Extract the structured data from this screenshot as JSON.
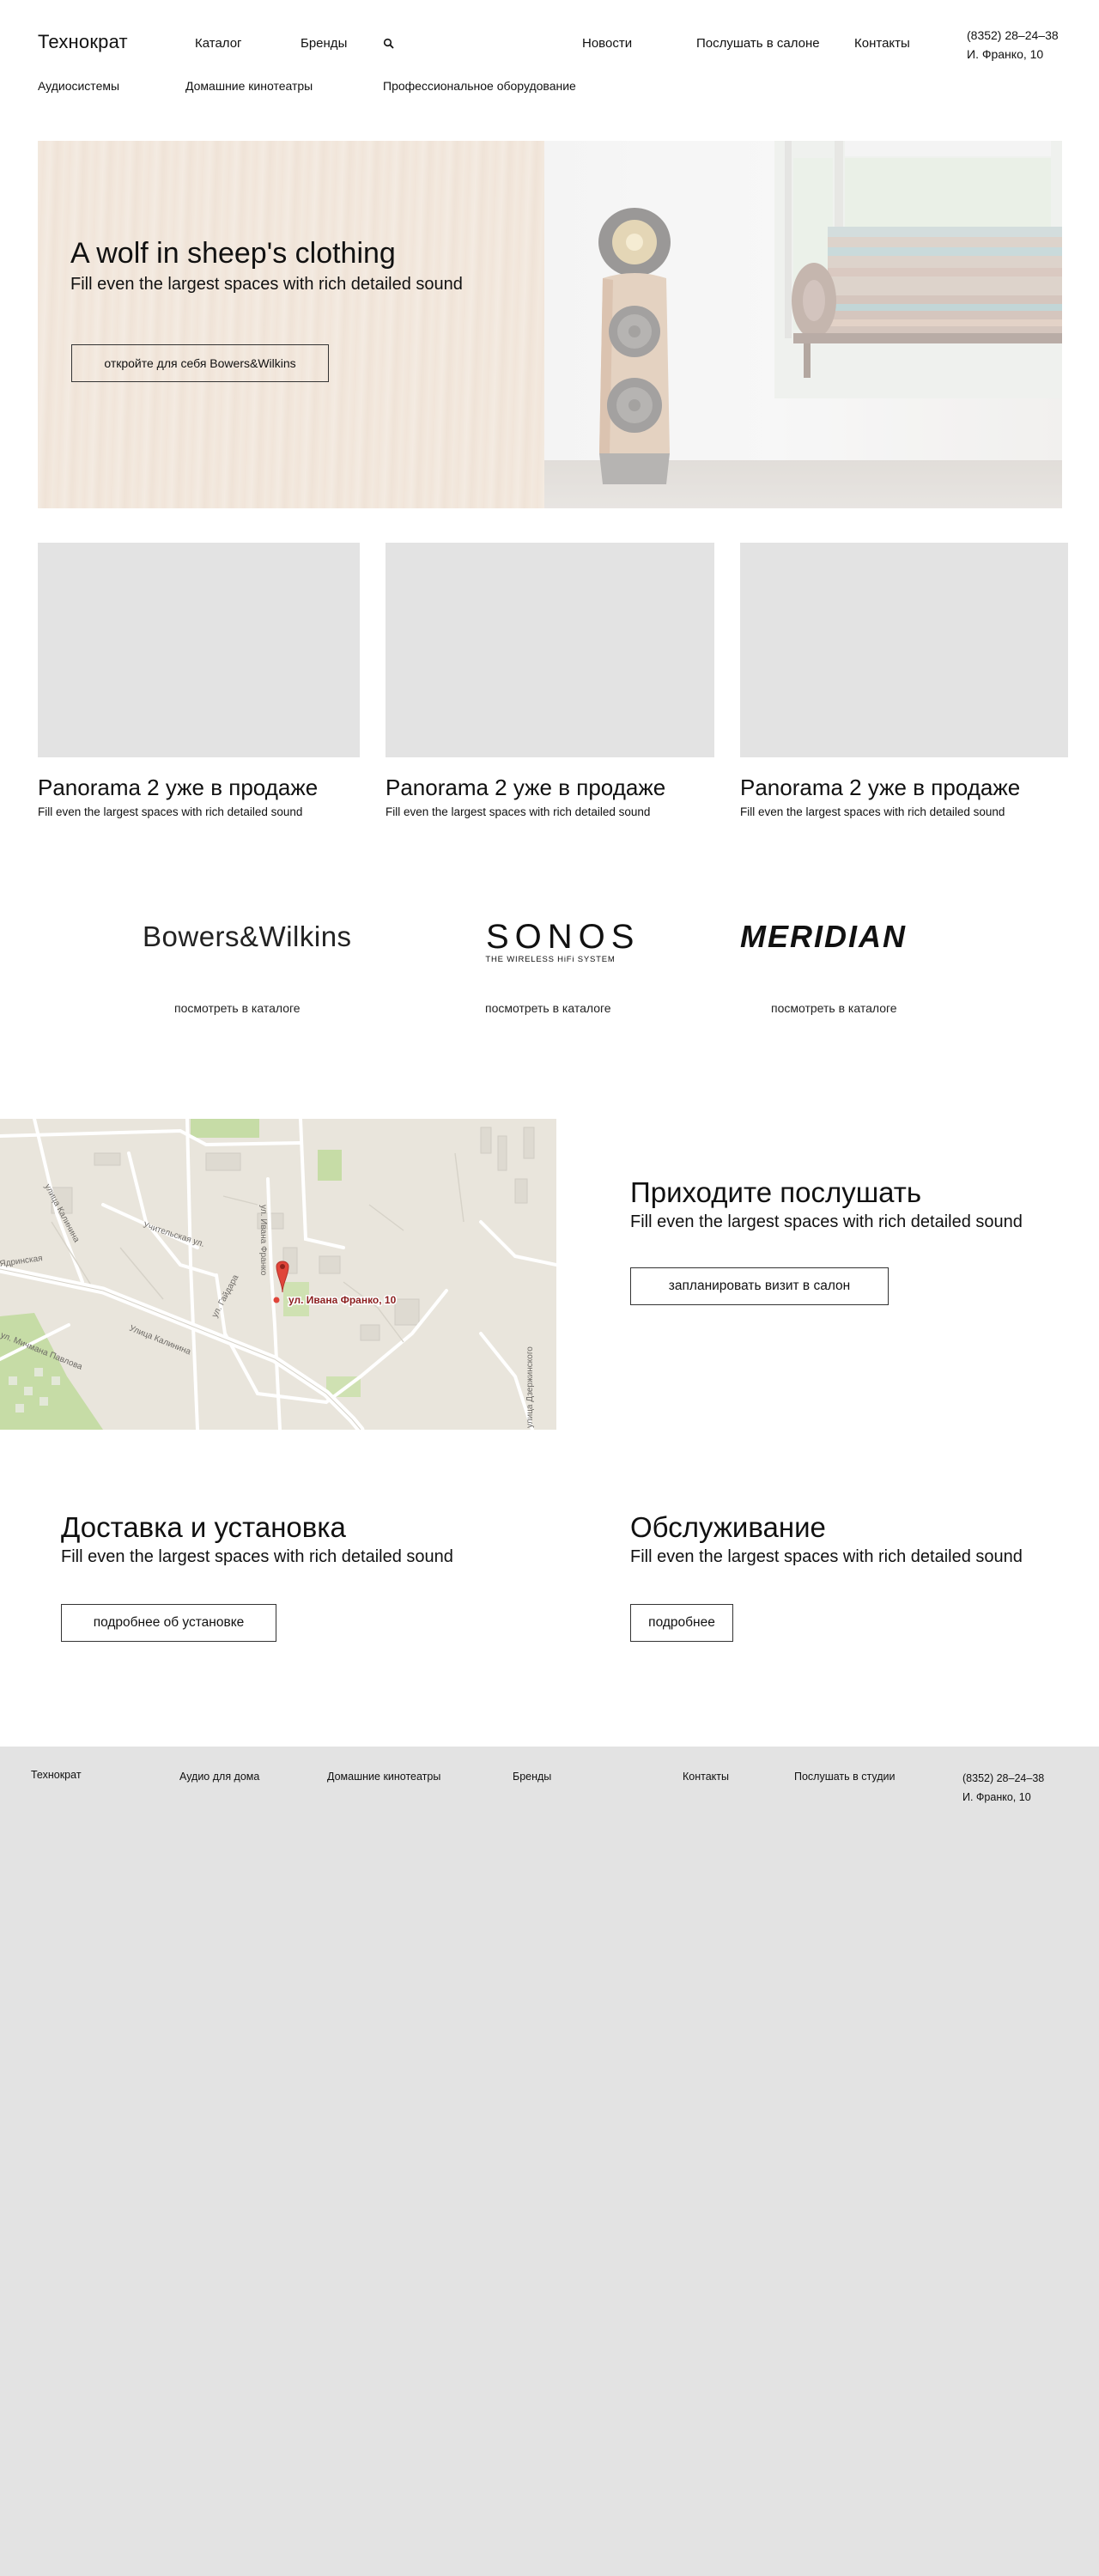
{
  "header": {
    "logo": "Технократ",
    "nav": [
      "Каталог",
      "Бренды",
      "Новости",
      "Послушать в салоне",
      "Контакты"
    ],
    "phone": "(8352) 28–24–38",
    "address": "И. Франко, 10",
    "subnav": [
      "Аудиосистемы",
      "Домашние кинотеатры",
      "Профессиональное оборудование"
    ],
    "icons": {
      "search": "search-icon"
    }
  },
  "hero": {
    "title": "A wolf in sheep's clothing",
    "subtitle": "Fill even the largest spaces with rich detailed sound",
    "button": "откройте для себя Bowers&Wilkins"
  },
  "cards": [
    {
      "title": "Panorama 2 уже в продаже",
      "subtitle": "Fill even the largest spaces with rich detailed sound"
    },
    {
      "title": "Panorama 2 уже в продаже",
      "subtitle": "Fill even the largest spaces with rich detailed sound"
    },
    {
      "title": "Panorama 2 уже в продаже",
      "subtitle": "Fill even the largest spaces with rich detailed sound"
    }
  ],
  "brands": [
    {
      "name": "Bowers&Wilkins",
      "link": "посмотреть в каталоге"
    },
    {
      "name": "SONOS",
      "tagline": "THE WIRELESS HiFi SYSTEM",
      "link": "посмотреть в каталоге"
    },
    {
      "name": "MERIDIAN",
      "link": "посмотреть в каталоге"
    }
  ],
  "map": {
    "address_label": "ул. Ивана Франко, 10",
    "streets": [
      "Улица Калинина",
      "ул. Гайдара",
      "ул. Ивана Франко",
      "Учительская ул.",
      "улица Калинина",
      "ул. Мичмана Павлова",
      "Ядринская",
      "улица Дзержинского"
    ]
  },
  "visit": {
    "title": "Приходите послушать",
    "subtitle": "Fill even the largest spaces with rich detailed sound",
    "button": "запланировать визит в салон"
  },
  "delivery": {
    "title": "Доставка и установка",
    "subtitle": "Fill even the largest spaces with rich detailed sound",
    "button": "подробнее об установке"
  },
  "service": {
    "title": "Обслуживание",
    "subtitle": "Fill even the largest spaces with rich detailed sound",
    "button": "подробнее"
  },
  "footer": {
    "logo": "Технократ",
    "links": [
      "Аудио для дома",
      "Домашние кинотеатры",
      "Бренды",
      "Контакты",
      "Послушать в студии"
    ],
    "phone": "(8352) 28–24–38",
    "address": "И. Франко, 10"
  },
  "colors": {
    "card_placeholder": "#e3e3e3",
    "footer_bg": "#e3e3e3",
    "map_pin": "#e0453a"
  }
}
